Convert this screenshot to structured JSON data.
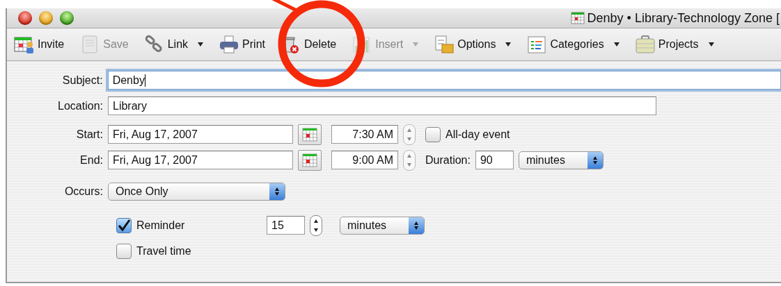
{
  "window": {
    "title": "Denby • Library-Technology Zone ["
  },
  "toolbar": [
    {
      "label": "Invite",
      "disabled": false,
      "dropdown": false
    },
    {
      "label": "Save",
      "disabled": true,
      "dropdown": false
    },
    {
      "label": "Link",
      "disabled": false,
      "dropdown": true
    },
    {
      "label": "Print",
      "disabled": false,
      "dropdown": false
    },
    {
      "label": "Delete",
      "disabled": false,
      "dropdown": false
    },
    {
      "label": "Insert",
      "disabled": true,
      "dropdown": true
    },
    {
      "label": "Options",
      "disabled": false,
      "dropdown": true
    },
    {
      "label": "Categories",
      "disabled": false,
      "dropdown": true
    },
    {
      "label": "Projects",
      "disabled": false,
      "dropdown": true
    }
  ],
  "form": {
    "subject": {
      "label": "Subject:",
      "value": "Denby",
      "focused": true
    },
    "location": {
      "label": "Location:",
      "value": "Library"
    },
    "start": {
      "label": "Start:",
      "date": "Fri, Aug 17, 2007",
      "time": "7:30 AM"
    },
    "all_day": {
      "label": "All-day event",
      "checked": false
    },
    "end": {
      "label": "End:",
      "date": "Fri, Aug 17, 2007",
      "time": "9:00 AM"
    },
    "duration": {
      "label": "Duration:",
      "value": "90",
      "unit": "minutes"
    },
    "occurs": {
      "label": "Occurs:",
      "value": "Once Only"
    },
    "reminder": {
      "label": "Reminder",
      "checked": true,
      "value": "15",
      "unit": "minutes"
    },
    "travel_time": {
      "label": "Travel time",
      "checked": false
    }
  }
}
